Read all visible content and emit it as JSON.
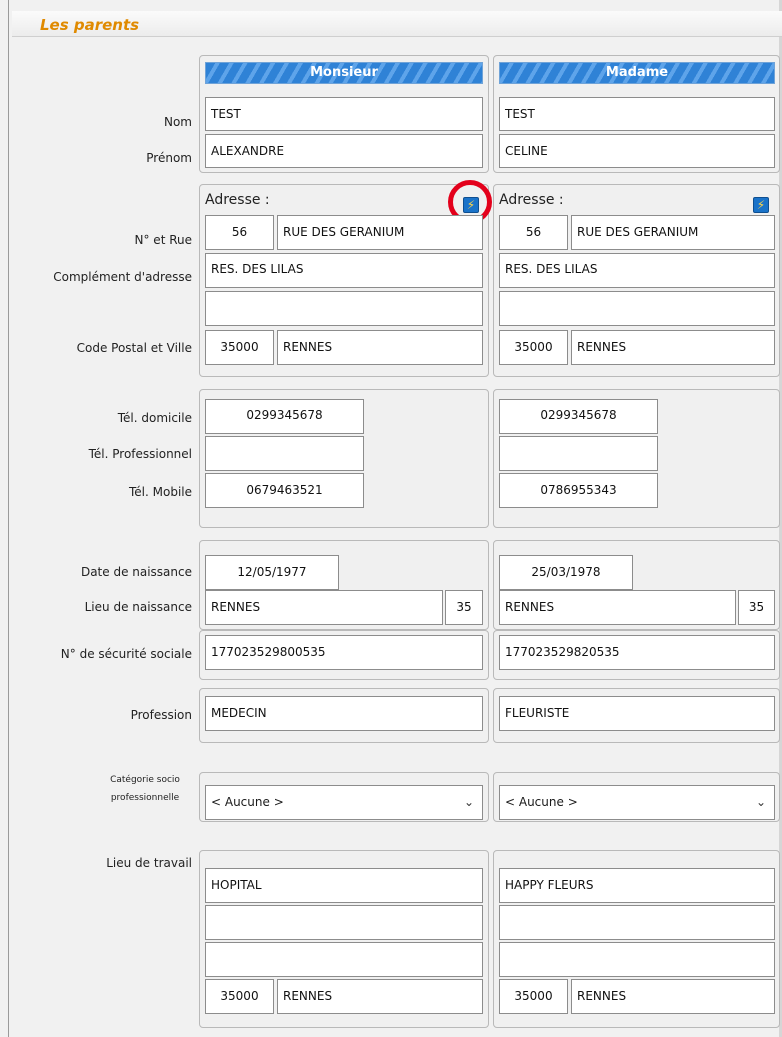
{
  "section_title": "Les parents",
  "columns": {
    "left": "Monsieur",
    "right": "Madame"
  },
  "labels": {
    "nom": "Nom",
    "prenom": "Prénom",
    "no_rue": "N° et Rue",
    "complement": "Complément d'adresse",
    "cp_ville": "Code Postal et Ville",
    "tel_domicile": "Tél. domicile",
    "tel_pro": "Tél. Professionnel",
    "tel_mobile": "Tél. Mobile",
    "date_naissance": "Date de naissance",
    "lieu_naissance": "Lieu de naissance",
    "secu": "N° de sécurité sociale",
    "profession": "Profession",
    "csp_line1": "Catégorie socio",
    "csp_line2": "professionnelle",
    "lieu_travail": "Lieu de travail",
    "adresse": "Adresse :"
  },
  "monsieur": {
    "nom": "TEST",
    "prenom": "ALEXANDRE",
    "numero": "56",
    "rue": "RUE DES GERANIUM",
    "complement1": "RES. DES LILAS",
    "complement2": "",
    "cp": "35000",
    "ville": "RENNES",
    "tel_domicile": "0299345678",
    "tel_pro": "",
    "tel_mobile": "0679463521",
    "date_naissance": "12/05/1977",
    "lieu_naissance": "RENNES",
    "dept_naissance": "35",
    "secu": "177023529800535",
    "profession": "MEDECIN",
    "csp": "< Aucune >",
    "travail1": "HOPITAL",
    "travail2": "",
    "travail3": "",
    "travail_cp": "35000",
    "travail_ville": "RENNES"
  },
  "madame": {
    "nom": "TEST",
    "prenom": "CELINE",
    "numero": "56",
    "rue": "RUE DES GERANIUM",
    "complement1": "RES. DES LILAS",
    "complement2": "",
    "cp": "35000",
    "ville": "RENNES",
    "tel_domicile": "0299345678",
    "tel_pro": "",
    "tel_mobile": "0786955343",
    "date_naissance": "25/03/1978",
    "lieu_naissance": "RENNES",
    "dept_naissance": "35",
    "secu": "177023529820535",
    "profession": "FLEURISTE",
    "csp": "< Aucune >",
    "travail1": "HAPPY FLEURS",
    "travail2": "",
    "travail3": "",
    "travail_cp": "35000",
    "travail_ville": "RENNES"
  },
  "icons": {
    "copy_address": "copy-address-icon",
    "dropdown": "chevron-down-icon"
  },
  "colors": {
    "title": "#e08a00",
    "header_blue": "#2f82d6",
    "highlight_red": "#e3001b"
  }
}
